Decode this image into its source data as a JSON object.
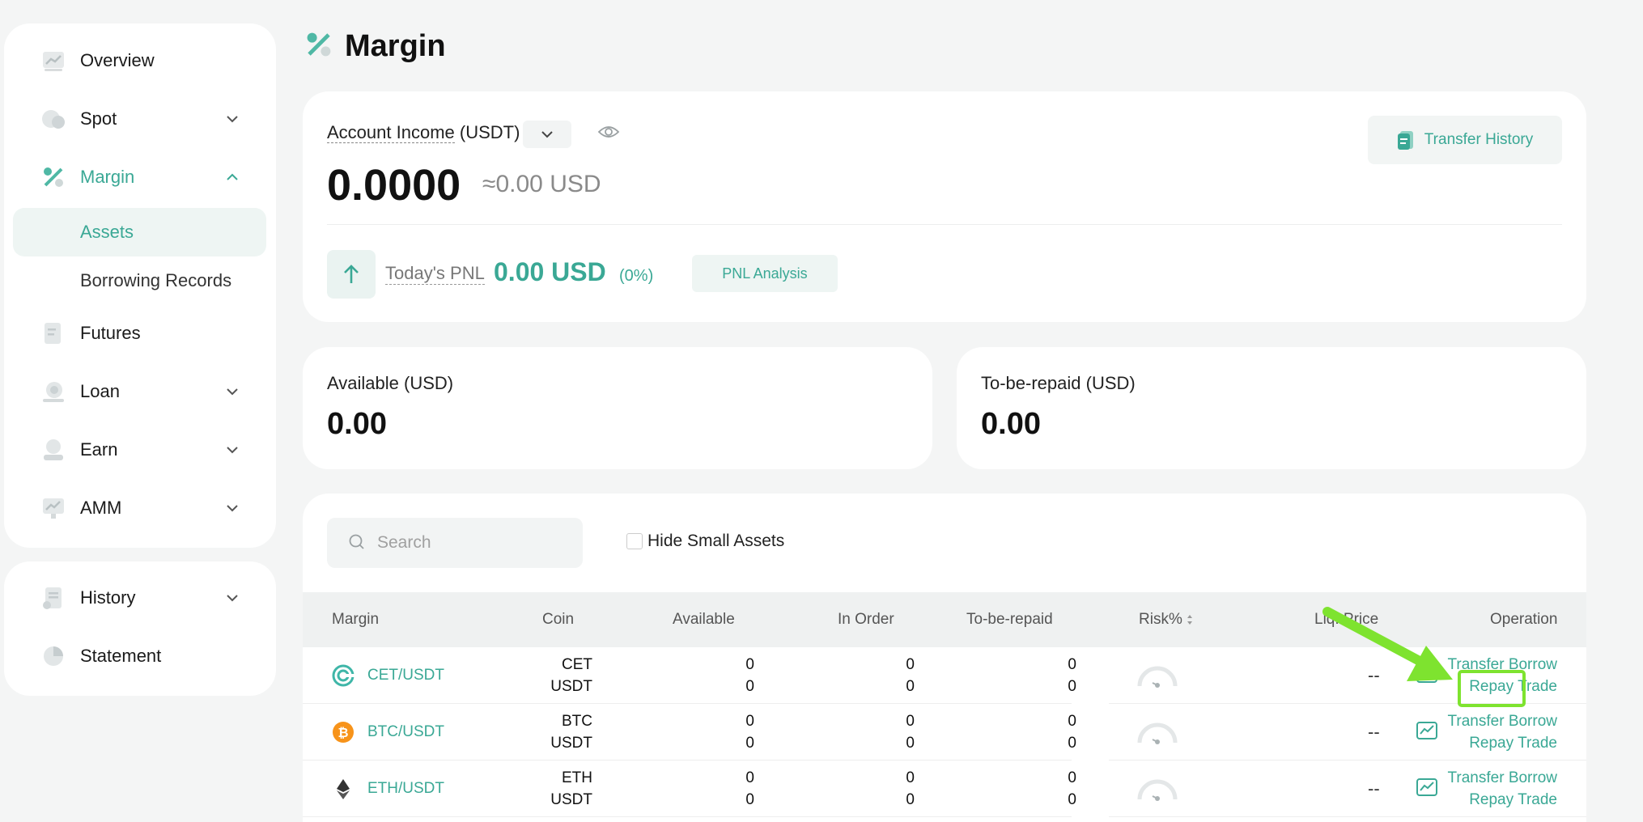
{
  "sidebar": {
    "items": [
      {
        "label": "Overview"
      },
      {
        "label": "Spot"
      },
      {
        "label": "Margin"
      },
      {
        "label": "Futures"
      },
      {
        "label": "Loan"
      },
      {
        "label": "Earn"
      },
      {
        "label": "AMM"
      }
    ],
    "margin_sub": [
      {
        "label": "Assets"
      },
      {
        "label": "Borrowing Records"
      }
    ],
    "bottom_items": [
      {
        "label": "History"
      },
      {
        "label": "Statement"
      }
    ]
  },
  "page": {
    "title": "Margin"
  },
  "income": {
    "label_prefix": "Account Income",
    "label_suffix": " (USDT)",
    "value": "0.0000",
    "usd_value": "≈0.00 USD",
    "transfer_history": "Transfer History",
    "pnl_label": "Today's PNL",
    "pnl_value": "0.00 USD",
    "pnl_percent": "(0%)",
    "pnl_analysis": "PNL Analysis"
  },
  "available": {
    "label": "Available (USD)",
    "value": "0.00"
  },
  "to_be_repaid": {
    "label": "To-be-repaid (USD)",
    "value": "0.00"
  },
  "table": {
    "search_placeholder": "Search",
    "hide_small": "Hide Small Assets",
    "headers": {
      "margin": "Margin",
      "coin": "Coin",
      "available": "Available",
      "in_order": "In Order",
      "to_be_repaid": "To-be-repaid",
      "risk": "Risk%",
      "liq_price": "Liq. Price",
      "operation": "Operation"
    },
    "rows": [
      {
        "pair": "CET/USDT",
        "coin1": "CET",
        "coin2": "USDT",
        "avail1": "0",
        "avail2": "0",
        "inorder1": "0",
        "inorder2": "0",
        "repaid1": "0",
        "repaid2": "0",
        "liq": "--",
        "ops": {
          "transfer": "Transfer",
          "borrow": "Borrow",
          "repay": "Repay",
          "trade": "Trade"
        }
      },
      {
        "pair": "BTC/USDT",
        "coin1": "BTC",
        "coin2": "USDT",
        "avail1": "0",
        "avail2": "0",
        "inorder1": "0",
        "inorder2": "0",
        "repaid1": "0",
        "repaid2": "0",
        "liq": "--",
        "ops": {
          "transfer": "Transfer",
          "borrow": "Borrow",
          "repay": "Repay",
          "trade": "Trade"
        }
      },
      {
        "pair": "ETH/USDT",
        "coin1": "ETH",
        "coin2": "USDT",
        "avail1": "0",
        "avail2": "0",
        "inorder1": "0",
        "inorder2": "0",
        "repaid1": "0",
        "repaid2": "0",
        "liq": "--",
        "ops": {
          "transfer": "Transfer",
          "borrow": "Borrow",
          "repay": "Repay",
          "trade": "Trade"
        }
      }
    ]
  },
  "colors": {
    "accent": "#3aa895",
    "annotation": "#7ee32f"
  }
}
